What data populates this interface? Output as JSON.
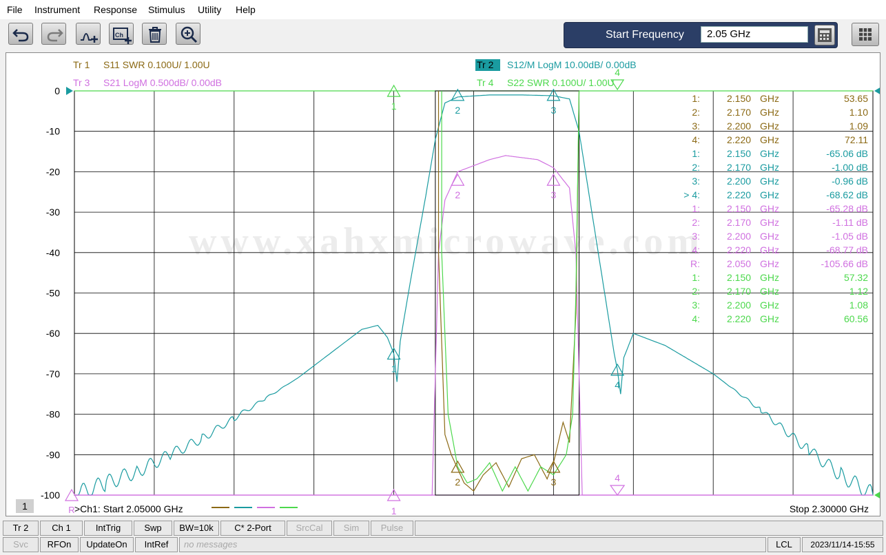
{
  "menu": [
    "File",
    "Instrument",
    "Response",
    "Stimulus",
    "Utility",
    "Help"
  ],
  "toolbar": {
    "buttons": [
      {
        "name": "undo-button",
        "icon": "undo-icon"
      },
      {
        "name": "redo-button",
        "icon": "redo-icon"
      },
      {
        "name": "add-marker-button",
        "icon": "marker-icon"
      },
      {
        "name": "add-channel-button",
        "icon": "channel-icon"
      },
      {
        "name": "delete-button",
        "icon": "trash-icon"
      },
      {
        "name": "zoom-button",
        "icon": "zoom-icon"
      }
    ],
    "entry_label": "Start Frequency",
    "entry_value": "2.05 GHz"
  },
  "traces": [
    {
      "id": "tr1",
      "label": "Tr 1",
      "desc": "S11 SWR 0.100U/  1.00U",
      "color": "#8B6914"
    },
    {
      "id": "tr2",
      "label": "Tr 2",
      "desc": "S12/M LogM 10.00dB/  0.00dB",
      "color": "#1a9ba0",
      "active": true
    },
    {
      "id": "tr3",
      "label": "Tr 3",
      "desc": "S21 LogM 0.500dB/  0.00dB",
      "color": "#d070e0"
    },
    {
      "id": "tr4",
      "label": "Tr 4",
      "desc": "S22 SWR 0.100U/  1.00U",
      "color": "#4cd84c"
    }
  ],
  "watermark": "www.xahxmicrowave.com",
  "marker_table": [
    {
      "id": "1:",
      "freq": "2.150",
      "unit": "GHz",
      "value": "53.65",
      "trace": "tr1"
    },
    {
      "id": "2:",
      "freq": "2.170",
      "unit": "GHz",
      "value": "1.10",
      "trace": "tr1"
    },
    {
      "id": "3:",
      "freq": "2.200",
      "unit": "GHz",
      "value": "1.09",
      "trace": "tr1"
    },
    {
      "id": "4:",
      "freq": "2.220",
      "unit": "GHz",
      "value": "72.11",
      "trace": "tr1"
    },
    {
      "id": "1:",
      "freq": "2.150",
      "unit": "GHz",
      "value": "-65.06 dB",
      "trace": "tr2"
    },
    {
      "id": "2:",
      "freq": "2.170",
      "unit": "GHz",
      "value": "-1.00 dB",
      "trace": "tr2"
    },
    {
      "id": "3:",
      "freq": "2.200",
      "unit": "GHz",
      "value": "-0.96 dB",
      "trace": "tr2"
    },
    {
      "id": "> 4:",
      "freq": "2.220",
      "unit": "GHz",
      "value": "-68.62 dB",
      "trace": "tr2"
    },
    {
      "id": "1:",
      "freq": "2.150",
      "unit": "GHz",
      "value": "-65.28 dB",
      "trace": "tr3"
    },
    {
      "id": "2:",
      "freq": "2.170",
      "unit": "GHz",
      "value": "-1.11 dB",
      "trace": "tr3"
    },
    {
      "id": "3:",
      "freq": "2.200",
      "unit": "GHz",
      "value": "-1.05 dB",
      "trace": "tr3"
    },
    {
      "id": "4:",
      "freq": "2.220",
      "unit": "GHz",
      "value": "-68.77 dB",
      "trace": "tr3"
    },
    {
      "id": "R:",
      "freq": "2.050",
      "unit": "GHz",
      "value": "-105.66 dB",
      "trace": "tr3"
    },
    {
      "id": "1:",
      "freq": "2.150",
      "unit": "GHz",
      "value": "57.32",
      "trace": "tr4"
    },
    {
      "id": "2:",
      "freq": "2.170",
      "unit": "GHz",
      "value": "1.12",
      "trace": "tr4"
    },
    {
      "id": "3:",
      "freq": "2.200",
      "unit": "GHz",
      "value": "1.08",
      "trace": "tr4"
    },
    {
      "id": "4:",
      "freq": "2.220",
      "unit": "GHz",
      "value": "60.56",
      "trace": "tr4"
    }
  ],
  "chart_data": {
    "type": "line",
    "x_start_ghz": 2.05,
    "x_stop_ghz": 2.3,
    "ylim": [
      -100,
      0
    ],
    "y_ticks": [
      0,
      -10,
      -20,
      -30,
      -40,
      -50,
      -60,
      -70,
      -80,
      -90,
      -100
    ],
    "grid": true,
    "start_label": ">Ch1:  Start  2.05000 GHz",
    "stop_label": "Stop  2.30000 GHz",
    "channel_number": "1",
    "series": [
      {
        "trace": "tr2",
        "points": [
          [
            2.05,
            -100
          ],
          [
            2.06,
            -97
          ],
          [
            2.07,
            -94
          ],
          [
            2.08,
            -90
          ],
          [
            2.09,
            -86
          ],
          [
            2.1,
            -81
          ],
          [
            2.11,
            -76
          ],
          [
            2.12,
            -71
          ],
          [
            2.13,
            -65
          ],
          [
            2.14,
            -59
          ],
          [
            2.145,
            -58
          ],
          [
            2.148,
            -61
          ],
          [
            2.15,
            -65
          ],
          [
            2.151,
            -72
          ],
          [
            2.152,
            -62
          ],
          [
            2.155,
            -48
          ],
          [
            2.16,
            -26
          ],
          [
            2.163,
            -12
          ],
          [
            2.166,
            -3
          ],
          [
            2.17,
            -1.5
          ],
          [
            2.18,
            -1.0
          ],
          [
            2.19,
            -1.0
          ],
          [
            2.2,
            -1.2
          ],
          [
            2.205,
            -2
          ],
          [
            2.208,
            -10
          ],
          [
            2.212,
            -30
          ],
          [
            2.216,
            -50
          ],
          [
            2.219,
            -65
          ],
          [
            2.22,
            -69
          ],
          [
            2.221,
            -75
          ],
          [
            2.222,
            -66
          ],
          [
            2.225,
            -60
          ],
          [
            2.235,
            -63
          ],
          [
            2.25,
            -70
          ],
          [
            2.265,
            -79
          ],
          [
            2.28,
            -89
          ],
          [
            2.29,
            -95
          ],
          [
            2.3,
            -100
          ]
        ]
      },
      {
        "trace": "tr3",
        "points": [
          [
            2.05,
            -100
          ],
          [
            2.162,
            -100
          ],
          [
            2.163,
            -70
          ],
          [
            2.164,
            -40
          ],
          [
            2.166,
            -27
          ],
          [
            2.17,
            -20
          ],
          [
            2.18,
            -17
          ],
          [
            2.185,
            -16
          ],
          [
            2.195,
            -17
          ],
          [
            2.2,
            -19
          ],
          [
            2.205,
            -24
          ],
          [
            2.207,
            -40
          ],
          [
            2.208,
            -70
          ],
          [
            2.209,
            -100
          ],
          [
            2.3,
            -100
          ]
        ]
      },
      {
        "trace": "tr1",
        "points": [
          [
            2.164,
            0
          ],
          [
            2.164,
            -40
          ],
          [
            2.166,
            -85
          ],
          [
            2.168,
            -90
          ],
          [
            2.172,
            -97
          ],
          [
            2.175,
            -99
          ],
          [
            2.178,
            -95
          ],
          [
            2.182,
            -92
          ],
          [
            2.186,
            -98
          ],
          [
            2.19,
            -91
          ],
          [
            2.194,
            -90
          ],
          [
            2.198,
            -96
          ],
          [
            2.2,
            -92
          ],
          [
            2.203,
            -82
          ],
          [
            2.205,
            -87
          ],
          [
            2.207,
            -55
          ],
          [
            2.208,
            0
          ]
        ]
      },
      {
        "trace": "tr4",
        "points": [
          [
            2.165,
            0
          ],
          [
            2.165,
            -40
          ],
          [
            2.167,
            -80
          ],
          [
            2.17,
            -93
          ],
          [
            2.173,
            -97
          ],
          [
            2.176,
            -96
          ],
          [
            2.18,
            -92
          ],
          [
            2.184,
            -99
          ],
          [
            2.188,
            -93
          ],
          [
            2.192,
            -99
          ],
          [
            2.196,
            -93
          ],
          [
            2.2,
            -95
          ],
          [
            2.204,
            -90
          ],
          [
            2.206,
            -80
          ],
          [
            2.207,
            -50
          ],
          [
            2.208,
            0
          ]
        ]
      }
    ],
    "markers": [
      {
        "trace": "tr2",
        "label": "1",
        "x": 2.15,
        "y": -65
      },
      {
        "trace": "tr2",
        "label": "2",
        "x": 2.17,
        "y": -1
      },
      {
        "trace": "tr2",
        "label": "3",
        "x": 2.2,
        "y": -1
      },
      {
        "trace": "tr2",
        "label": "4",
        "x": 2.22,
        "y": -69
      },
      {
        "trace": "tr3",
        "label": "2",
        "x": 2.17,
        "y": -22
      },
      {
        "trace": "tr3",
        "label": "3",
        "x": 2.2,
        "y": -22
      },
      {
        "trace": "tr1",
        "label": "2",
        "x": 2.17,
        "y": -93
      },
      {
        "trace": "tr1",
        "label": "3",
        "x": 2.2,
        "y": -93
      }
    ]
  },
  "status_row1": [
    {
      "label": "Tr 2",
      "enabled": true
    },
    {
      "label": "Ch 1",
      "enabled": true
    },
    {
      "label": "IntTrig",
      "enabled": true
    },
    {
      "label": "Swp",
      "enabled": true
    },
    {
      "label": "BW=10k",
      "enabled": true
    },
    {
      "label": "C* 2-Port",
      "enabled": true
    },
    {
      "label": "SrcCal",
      "enabled": false
    },
    {
      "label": "Sim",
      "enabled": false
    },
    {
      "label": "Pulse",
      "enabled": false
    }
  ],
  "status_row2": [
    {
      "label": "Svc",
      "enabled": false
    },
    {
      "label": "RFOn",
      "enabled": true
    },
    {
      "label": "UpdateOn",
      "enabled": true
    },
    {
      "label": "IntRef",
      "enabled": true
    }
  ],
  "message": "no messages",
  "lcl": "LCL",
  "timestamp": "2023/11/14-15:55"
}
